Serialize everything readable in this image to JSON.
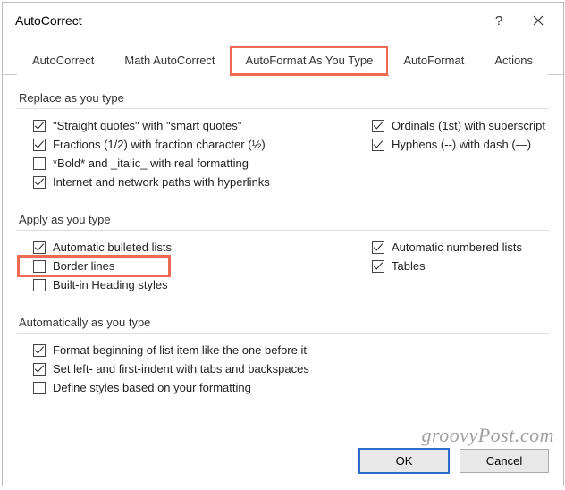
{
  "window": {
    "title": "AutoCorrect",
    "help": "?",
    "close_icon": "close-icon"
  },
  "tabs": [
    {
      "label": "AutoCorrect",
      "active": false
    },
    {
      "label": "Math AutoCorrect",
      "active": false
    },
    {
      "label": "AutoFormat As You Type",
      "active": true,
      "highlight": true
    },
    {
      "label": "AutoFormat",
      "active": false
    },
    {
      "label": "Actions",
      "active": false
    }
  ],
  "sections": {
    "replace": {
      "title": "Replace as you type",
      "left": [
        {
          "label": "\"Straight quotes\" with \"smart quotes\"",
          "checked": true
        },
        {
          "label": "Fractions (1/2) with fraction character (½)",
          "checked": true
        },
        {
          "label": "*Bold* and _italic_ with real formatting",
          "checked": false
        },
        {
          "label": "Internet and network paths with hyperlinks",
          "checked": true
        }
      ],
      "right": [
        {
          "label": "Ordinals (1st) with superscript",
          "checked": true
        },
        {
          "label": "Hyphens (--) with dash (—)",
          "checked": true
        }
      ]
    },
    "apply": {
      "title": "Apply as you type",
      "left": [
        {
          "label": "Automatic bulleted lists",
          "checked": true
        },
        {
          "label": "Border lines",
          "checked": false,
          "highlight": true
        },
        {
          "label": "Built-in Heading styles",
          "checked": false
        }
      ],
      "right": [
        {
          "label": "Automatic numbered lists",
          "checked": true
        },
        {
          "label": "Tables",
          "checked": true
        }
      ]
    },
    "auto": {
      "title": "Automatically as you type",
      "items": [
        {
          "label": "Format beginning of list item like the one before it",
          "checked": true
        },
        {
          "label": "Set left- and first-indent with tabs and backspaces",
          "checked": true
        },
        {
          "label": "Define styles based on your formatting",
          "checked": false
        }
      ]
    }
  },
  "buttons": {
    "ok": "OK",
    "cancel": "Cancel"
  },
  "watermark": "groovyPost.com"
}
